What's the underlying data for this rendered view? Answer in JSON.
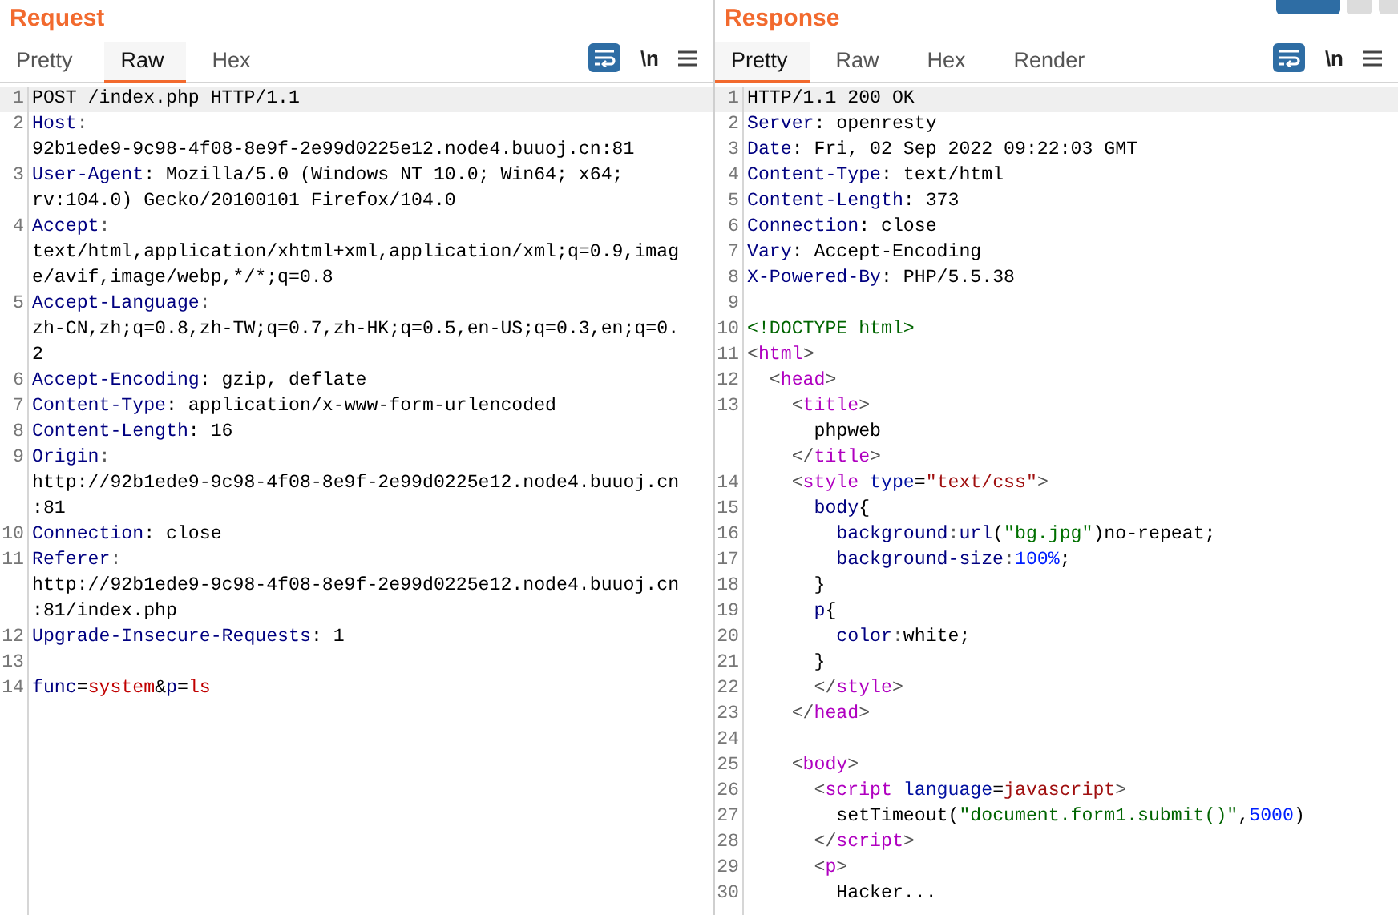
{
  "panes": [
    {
      "title": "Request",
      "tabs": [
        {
          "label": "Pretty",
          "selected": false
        },
        {
          "label": "Raw",
          "selected": true
        },
        {
          "label": "Hex",
          "selected": false
        }
      ],
      "wrap_on": true,
      "newline_label": "\\n",
      "lines": [
        {
          "number": "1",
          "highlighted": true,
          "rows": [
            {
              "parts": [
                {
                  "kind": "plain",
                  "text": "POST /index.php HTTP/1.1"
                }
              ]
            }
          ]
        },
        {
          "number": "2",
          "highlighted": false,
          "rows": [
            {
              "parts": [
                {
                  "kind": "name",
                  "text": "Host"
                },
                {
                  "kind": "punct",
                  "text": ":"
                }
              ]
            },
            {
              "parts": [
                {
                  "kind": "plain",
                  "text": "92b1ede9-9c98-4f08-8e9f-2e99d0225e12.node4.buuoj.cn:81"
                }
              ]
            }
          ]
        },
        {
          "number": "3",
          "highlighted": false,
          "rows": [
            {
              "parts": [
                {
                  "kind": "name",
                  "text": "User-Agent"
                },
                {
                  "kind": "plain",
                  "text": ": Mozilla/5.0 (Windows NT 10.0; Win64; x64;"
                }
              ]
            },
            {
              "parts": [
                {
                  "kind": "plain",
                  "text": "rv:104.0) Gecko/20100101 Firefox/104.0"
                }
              ]
            }
          ]
        },
        {
          "number": "4",
          "highlighted": false,
          "rows": [
            {
              "parts": [
                {
                  "kind": "name",
                  "text": "Accept"
                },
                {
                  "kind": "punct",
                  "text": ":"
                }
              ]
            },
            {
              "parts": [
                {
                  "kind": "plain",
                  "text": "text/html,application/xhtml+xml,application/xml;q=0.9,imag"
                }
              ]
            },
            {
              "parts": [
                {
                  "kind": "plain",
                  "text": "e/avif,image/webp,*/*;q=0.8"
                }
              ]
            }
          ]
        },
        {
          "number": "5",
          "highlighted": false,
          "rows": [
            {
              "parts": [
                {
                  "kind": "name",
                  "text": "Accept-Language"
                },
                {
                  "kind": "punct",
                  "text": ":"
                }
              ]
            },
            {
              "parts": [
                {
                  "kind": "plain",
                  "text": "zh-CN,zh;q=0.8,zh-TW;q=0.7,zh-HK;q=0.5,en-US;q=0.3,en;q=0."
                }
              ]
            },
            {
              "parts": [
                {
                  "kind": "plain",
                  "text": "2"
                }
              ]
            }
          ]
        },
        {
          "number": "6",
          "highlighted": false,
          "rows": [
            {
              "parts": [
                {
                  "kind": "name",
                  "text": "Accept-Encoding"
                },
                {
                  "kind": "plain",
                  "text": ": gzip, deflate"
                }
              ]
            }
          ]
        },
        {
          "number": "7",
          "highlighted": false,
          "rows": [
            {
              "parts": [
                {
                  "kind": "name",
                  "text": "Content-Type"
                },
                {
                  "kind": "plain",
                  "text": ": application/x-www-form-urlencoded"
                }
              ]
            }
          ]
        },
        {
          "number": "8",
          "highlighted": false,
          "rows": [
            {
              "parts": [
                {
                  "kind": "name",
                  "text": "Content-Length"
                },
                {
                  "kind": "plain",
                  "text": ": 16"
                }
              ]
            }
          ]
        },
        {
          "number": "9",
          "highlighted": false,
          "rows": [
            {
              "parts": [
                {
                  "kind": "name",
                  "text": "Origin"
                },
                {
                  "kind": "punct",
                  "text": ":"
                }
              ]
            },
            {
              "parts": [
                {
                  "kind": "plain",
                  "text": "http://92b1ede9-9c98-4f08-8e9f-2e99d0225e12.node4.buuoj.cn"
                }
              ]
            },
            {
              "parts": [
                {
                  "kind": "plain",
                  "text": ":81"
                }
              ]
            }
          ]
        },
        {
          "number": "10",
          "highlighted": false,
          "rows": [
            {
              "parts": [
                {
                  "kind": "name",
                  "text": "Connection"
                },
                {
                  "kind": "plain",
                  "text": ": close"
                }
              ]
            }
          ]
        },
        {
          "number": "11",
          "highlighted": false,
          "rows": [
            {
              "parts": [
                {
                  "kind": "name",
                  "text": "Referer"
                },
                {
                  "kind": "punct",
                  "text": ":"
                }
              ]
            },
            {
              "parts": [
                {
                  "kind": "plain",
                  "text": "http://92b1ede9-9c98-4f08-8e9f-2e99d0225e12.node4.buuoj.cn"
                }
              ]
            },
            {
              "parts": [
                {
                  "kind": "plain",
                  "text": ":81/index.php"
                }
              ]
            }
          ]
        },
        {
          "number": "12",
          "highlighted": false,
          "rows": [
            {
              "parts": [
                {
                  "kind": "name",
                  "text": "Upgrade-Insecure-Requests"
                },
                {
                  "kind": "plain",
                  "text": ": 1"
                }
              ]
            }
          ]
        },
        {
          "number": "13",
          "highlighted": false
        },
        {
          "number": "14",
          "highlighted": false,
          "rows": [
            {
              "parts": [
                {
                  "kind": "name",
                  "text": "func"
                },
                {
                  "kind": "plain",
                  "text": "="
                },
                {
                  "kind": "value",
                  "text": "system"
                },
                {
                  "kind": "plain",
                  "text": "&"
                },
                {
                  "kind": "name",
                  "text": "p"
                },
                {
                  "kind": "plain",
                  "text": "="
                },
                {
                  "kind": "value",
                  "text": "ls"
                }
              ]
            }
          ]
        }
      ]
    },
    {
      "title": "Response",
      "tabs": [
        {
          "label": "Pretty",
          "selected": true
        },
        {
          "label": "Raw",
          "selected": false
        },
        {
          "label": "Hex",
          "selected": false
        },
        {
          "label": "Render",
          "selected": false
        }
      ],
      "wrap_on": true,
      "newline_label": "\\n",
      "layout_buttons": [
        {
          "selected": true
        },
        {
          "selected": false
        },
        {
          "selected": false
        }
      ],
      "lines": [
        {
          "number": "1",
          "highlighted": true,
          "rows": [
            {
              "parts": [
                {
                  "kind": "plain",
                  "text": "HTTP/1.1 200 OK"
                }
              ]
            }
          ]
        },
        {
          "number": "2",
          "highlighted": false,
          "rows": [
            {
              "parts": [
                {
                  "kind": "name",
                  "text": "Server"
                },
                {
                  "kind": "plain",
                  "text": ": openresty"
                }
              ]
            }
          ]
        },
        {
          "number": "3",
          "highlighted": false,
          "rows": [
            {
              "parts": [
                {
                  "kind": "name",
                  "text": "Date"
                },
                {
                  "kind": "plain",
                  "text": ": Fri, 02 Sep 2022 09:22:03 GMT"
                }
              ]
            }
          ]
        },
        {
          "number": "4",
          "highlighted": false,
          "rows": [
            {
              "parts": [
                {
                  "kind": "name",
                  "text": "Content-Type"
                },
                {
                  "kind": "plain",
                  "text": ": text/html"
                }
              ]
            }
          ]
        },
        {
          "number": "5",
          "highlighted": false,
          "rows": [
            {
              "parts": [
                {
                  "kind": "name",
                  "text": "Content-Length"
                },
                {
                  "kind": "plain",
                  "text": ": 373"
                }
              ]
            }
          ]
        },
        {
          "number": "6",
          "highlighted": false,
          "rows": [
            {
              "parts": [
                {
                  "kind": "name",
                  "text": "Connection"
                },
                {
                  "kind": "plain",
                  "text": ": close"
                }
              ]
            }
          ]
        },
        {
          "number": "7",
          "highlighted": false,
          "rows": [
            {
              "parts": [
                {
                  "kind": "name",
                  "text": "Vary"
                },
                {
                  "kind": "plain",
                  "text": ": Accept-Encoding"
                }
              ]
            }
          ]
        },
        {
          "number": "8",
          "highlighted": false,
          "rows": [
            {
              "parts": [
                {
                  "kind": "name",
                  "text": "X-Powered-By"
                },
                {
                  "kind": "plain",
                  "text": ": PHP/5.5.38"
                }
              ]
            }
          ]
        },
        {
          "number": "9",
          "highlighted": false
        },
        {
          "number": "10",
          "highlighted": false,
          "rows": [
            {
              "parts": [
                {
                  "kind": "doctype",
                  "text": "<!DOCTYPE html>"
                }
              ]
            }
          ]
        },
        {
          "number": "11",
          "highlighted": false,
          "rows": [
            {
              "parts": [
                {
                  "kind": "punct",
                  "text": "<"
                },
                {
                  "kind": "tag",
                  "text": "html"
                },
                {
                  "kind": "punct",
                  "text": ">"
                }
              ]
            }
          ]
        },
        {
          "number": "12",
          "highlighted": false,
          "rows": [
            {
              "parts": [
                {
                  "kind": "punct",
                  "text": "  <"
                },
                {
                  "kind": "tag",
                  "text": "head"
                },
                {
                  "kind": "punct",
                  "text": ">"
                }
              ]
            }
          ]
        },
        {
          "number": "13",
          "highlighted": false,
          "rows": [
            {
              "parts": [
                {
                  "kind": "punct",
                  "text": "    <"
                },
                {
                  "kind": "tag",
                  "text": "title"
                },
                {
                  "kind": "punct",
                  "text": ">"
                }
              ]
            },
            {
              "parts": [
                {
                  "kind": "plain",
                  "text": "      phpweb"
                }
              ]
            },
            {
              "parts": [
                {
                  "kind": "punct",
                  "text": "    </"
                },
                {
                  "kind": "tag",
                  "text": "title"
                },
                {
                  "kind": "punct",
                  "text": ">"
                }
              ]
            }
          ]
        },
        {
          "number": "14",
          "highlighted": false,
          "rows": [
            {
              "parts": [
                {
                  "kind": "punct",
                  "text": "    <"
                },
                {
                  "kind": "tag",
                  "text": "style"
                },
                {
                  "kind": "attr",
                  "text": " type"
                },
                {
                  "kind": "plain",
                  "text": "="
                },
                {
                  "kind": "string",
                  "text": "\"text/css\""
                },
                {
                  "kind": "punct",
                  "text": ">"
                }
              ]
            }
          ]
        },
        {
          "number": "15",
          "highlighted": false,
          "rows": [
            {
              "parts": [
                {
                  "kind": "name",
                  "text": "      body"
                },
                {
                  "kind": "plain",
                  "text": "{"
                }
              ]
            }
          ]
        },
        {
          "number": "16",
          "highlighted": false,
          "rows": [
            {
              "parts": [
                {
                  "kind": "name",
                  "text": "        background"
                },
                {
                  "kind": "punct",
                  "text": ":"
                },
                {
                  "kind": "name",
                  "text": "url"
                },
                {
                  "kind": "plain",
                  "text": "("
                },
                {
                  "kind": "css_string",
                  "text": "\"bg.jpg\""
                },
                {
                  "kind": "plain",
                  "text": ")no-repeat;"
                }
              ]
            }
          ]
        },
        {
          "number": "17",
          "highlighted": false,
          "rows": [
            {
              "parts": [
                {
                  "kind": "name",
                  "text": "        background-size"
                },
                {
                  "kind": "punct",
                  "text": ":"
                },
                {
                  "kind": "number",
                  "text": "100%"
                },
                {
                  "kind": "plain",
                  "text": ";"
                }
              ]
            }
          ]
        },
        {
          "number": "18",
          "highlighted": false,
          "rows": [
            {
              "parts": [
                {
                  "kind": "plain",
                  "text": "      }"
                }
              ]
            }
          ]
        },
        {
          "number": "19",
          "highlighted": false,
          "rows": [
            {
              "parts": [
                {
                  "kind": "name",
                  "text": "      p"
                },
                {
                  "kind": "plain",
                  "text": "{"
                }
              ]
            }
          ]
        },
        {
          "number": "20",
          "highlighted": false,
          "rows": [
            {
              "parts": [
                {
                  "kind": "name",
                  "text": "        color"
                },
                {
                  "kind": "punct",
                  "text": ":"
                },
                {
                  "kind": "plain",
                  "text": "white;"
                }
              ]
            }
          ]
        },
        {
          "number": "21",
          "highlighted": false,
          "rows": [
            {
              "parts": [
                {
                  "kind": "plain",
                  "text": "      }"
                }
              ]
            }
          ]
        },
        {
          "number": "22",
          "highlighted": false,
          "rows": [
            {
              "parts": [
                {
                  "kind": "punct",
                  "text": "      </"
                },
                {
                  "kind": "tag",
                  "text": "style"
                },
                {
                  "kind": "punct",
                  "text": ">"
                }
              ]
            }
          ]
        },
        {
          "number": "23",
          "highlighted": false,
          "rows": [
            {
              "parts": [
                {
                  "kind": "punct",
                  "text": "    </"
                },
                {
                  "kind": "tag",
                  "text": "head"
                },
                {
                  "kind": "punct",
                  "text": ">"
                }
              ]
            }
          ]
        },
        {
          "number": "24",
          "highlighted": false
        },
        {
          "number": "25",
          "highlighted": false,
          "rows": [
            {
              "parts": [
                {
                  "kind": "punct",
                  "text": "    <"
                },
                {
                  "kind": "tag",
                  "text": "body"
                },
                {
                  "kind": "punct",
                  "text": ">"
                }
              ]
            }
          ]
        },
        {
          "number": "26",
          "highlighted": false,
          "rows": [
            {
              "parts": [
                {
                  "kind": "punct",
                  "text": "      <"
                },
                {
                  "kind": "tag",
                  "text": "script"
                },
                {
                  "kind": "attr",
                  "text": " language"
                },
                {
                  "kind": "plain",
                  "text": "="
                },
                {
                  "kind": "string",
                  "text": "javascript"
                },
                {
                  "kind": "punct",
                  "text": ">"
                }
              ]
            }
          ]
        },
        {
          "number": "27",
          "highlighted": false,
          "rows": [
            {
              "parts": [
                {
                  "kind": "plain",
                  "text": "        setTimeout("
                },
                {
                  "kind": "doctype",
                  "text": "\"document.form1.submit()\""
                },
                {
                  "kind": "plain",
                  "text": ","
                },
                {
                  "kind": "number",
                  "text": "5000"
                },
                {
                  "kind": "plain",
                  "text": ")"
                }
              ]
            }
          ]
        },
        {
          "number": "28",
          "highlighted": false,
          "rows": [
            {
              "parts": [
                {
                  "kind": "punct",
                  "text": "      </"
                },
                {
                  "kind": "tag",
                  "text": "script"
                },
                {
                  "kind": "punct",
                  "text": ">"
                }
              ]
            }
          ]
        },
        {
          "number": "29",
          "highlighted": false,
          "rows": [
            {
              "parts": [
                {
                  "kind": "punct",
                  "text": "      <"
                },
                {
                  "kind": "tag",
                  "text": "p"
                },
                {
                  "kind": "punct",
                  "text": ">"
                }
              ]
            }
          ]
        },
        {
          "number": "30",
          "highlighted": false,
          "rows": [
            {
              "parts": [
                {
                  "kind": "plain",
                  "text": "        Hacker..."
                }
              ]
            }
          ]
        }
      ]
    }
  ]
}
